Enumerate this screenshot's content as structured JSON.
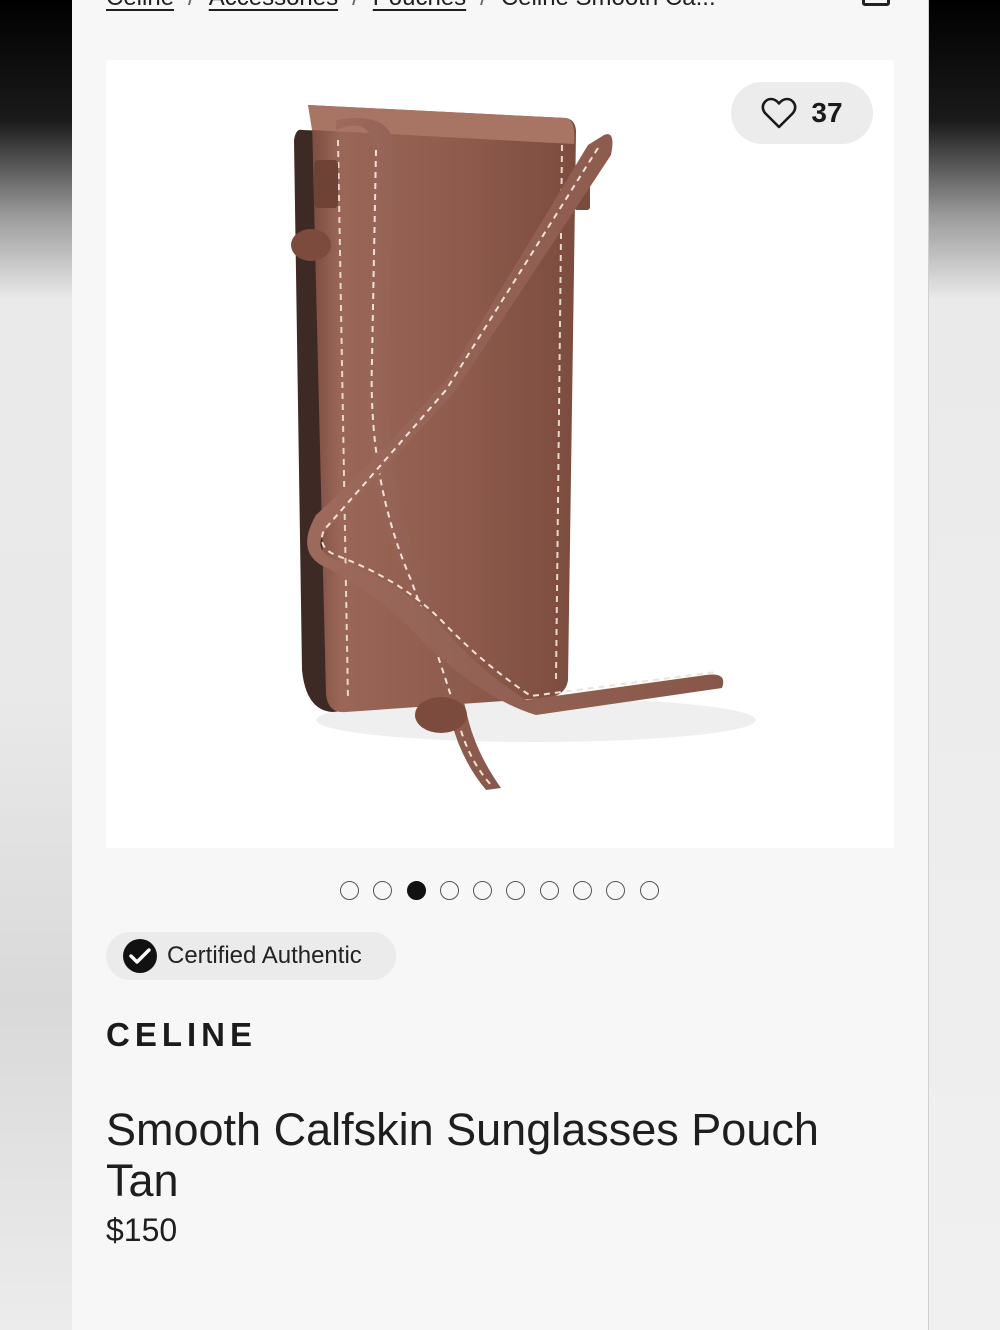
{
  "breadcrumb": {
    "items": [
      "Celine",
      "Accessories",
      "Pouches",
      "Celine Smooth Ca..."
    ],
    "separator": "/"
  },
  "icons": {
    "cart": "shopping-bag-icon",
    "favorite": "heart-icon",
    "verified": "checkmark-circle-icon"
  },
  "favorites": {
    "count": "37"
  },
  "gallery": {
    "total_images": 10,
    "active_index": 2
  },
  "badge": {
    "label": "Certified Authentic"
  },
  "product": {
    "brand": "CELINE",
    "title": "Smooth Calfskin Sunglasses Pouch Tan",
    "price": "$150",
    "color_hex": "#8b5a4c"
  }
}
